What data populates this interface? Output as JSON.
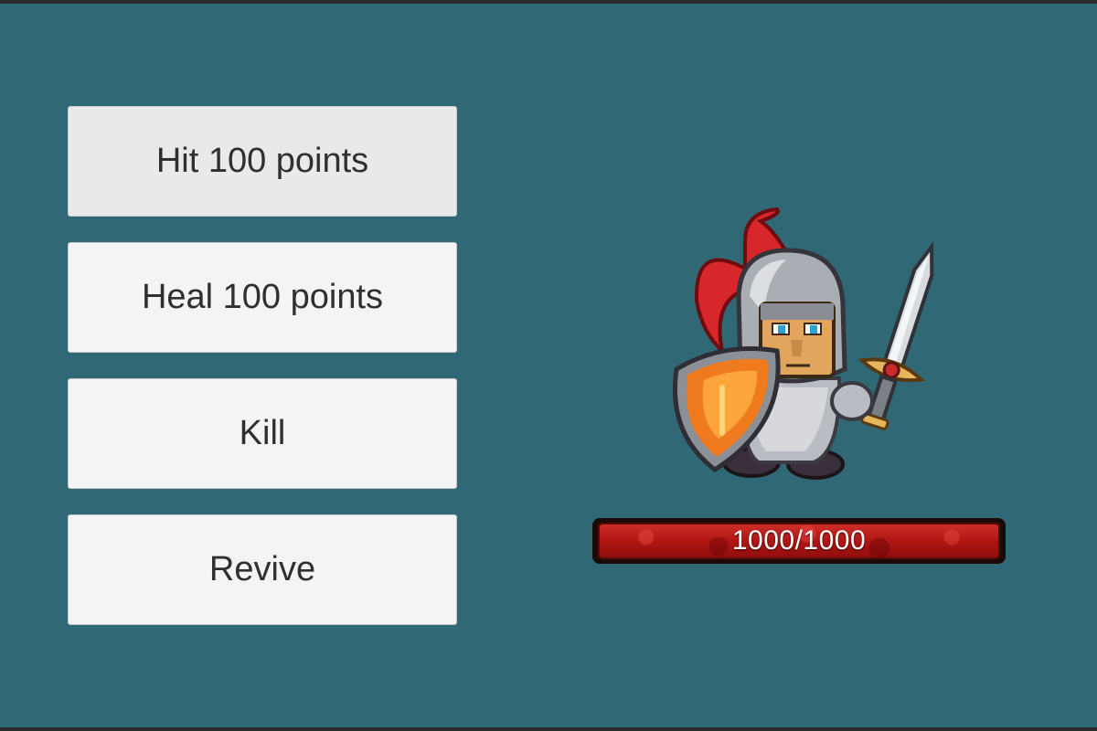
{
  "buttons": {
    "hit_label": "Hit 100 points",
    "heal_label": "Heal 100 points",
    "kill_label": "Kill",
    "revive_label": "Revive"
  },
  "character": {
    "icon": "knight-sprite-icon"
  },
  "health": {
    "current": 1000,
    "max": 1000,
    "fill_fraction": 1.0,
    "text": "1000/1000"
  },
  "colors": {
    "background": "#316875",
    "button_face": "#f4f4f4",
    "health_red": "#b01614"
  }
}
